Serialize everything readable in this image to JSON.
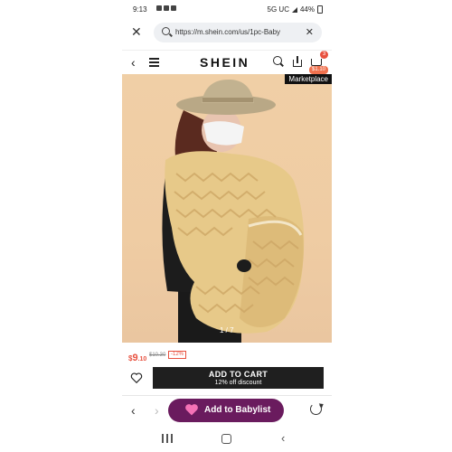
{
  "status_bar": {
    "time": "9:13",
    "network": "5G UC",
    "battery": "44%"
  },
  "browser": {
    "url": "https://m.shein.com/us/1pc-Baby"
  },
  "site_header": {
    "logo": "SHEIN",
    "cart_count": "3",
    "cart_total": "$1.10"
  },
  "product": {
    "marketplace_label": "Marketplace",
    "image_counter": "1 / 7",
    "price_currency": "$",
    "price_whole": "9",
    "price_decimal": ".10",
    "original_price": "$10.30",
    "discount": "-12%"
  },
  "actions": {
    "add_to_cart": "ADD TO CART",
    "add_to_cart_sub": "12% off discount"
  },
  "bottom_bar": {
    "babylist_label": "Add to Babylist"
  },
  "colors": {
    "accent": "#e8513f",
    "babylist": "#6a1b5e",
    "button_dark": "#1f1f1f"
  },
  "icons": [
    "close-icon",
    "search-icon",
    "back-icon",
    "menu-icon",
    "share-icon",
    "cart-icon",
    "heart-icon",
    "forward-icon",
    "reload-icon",
    "recents-icon",
    "home-icon"
  ]
}
